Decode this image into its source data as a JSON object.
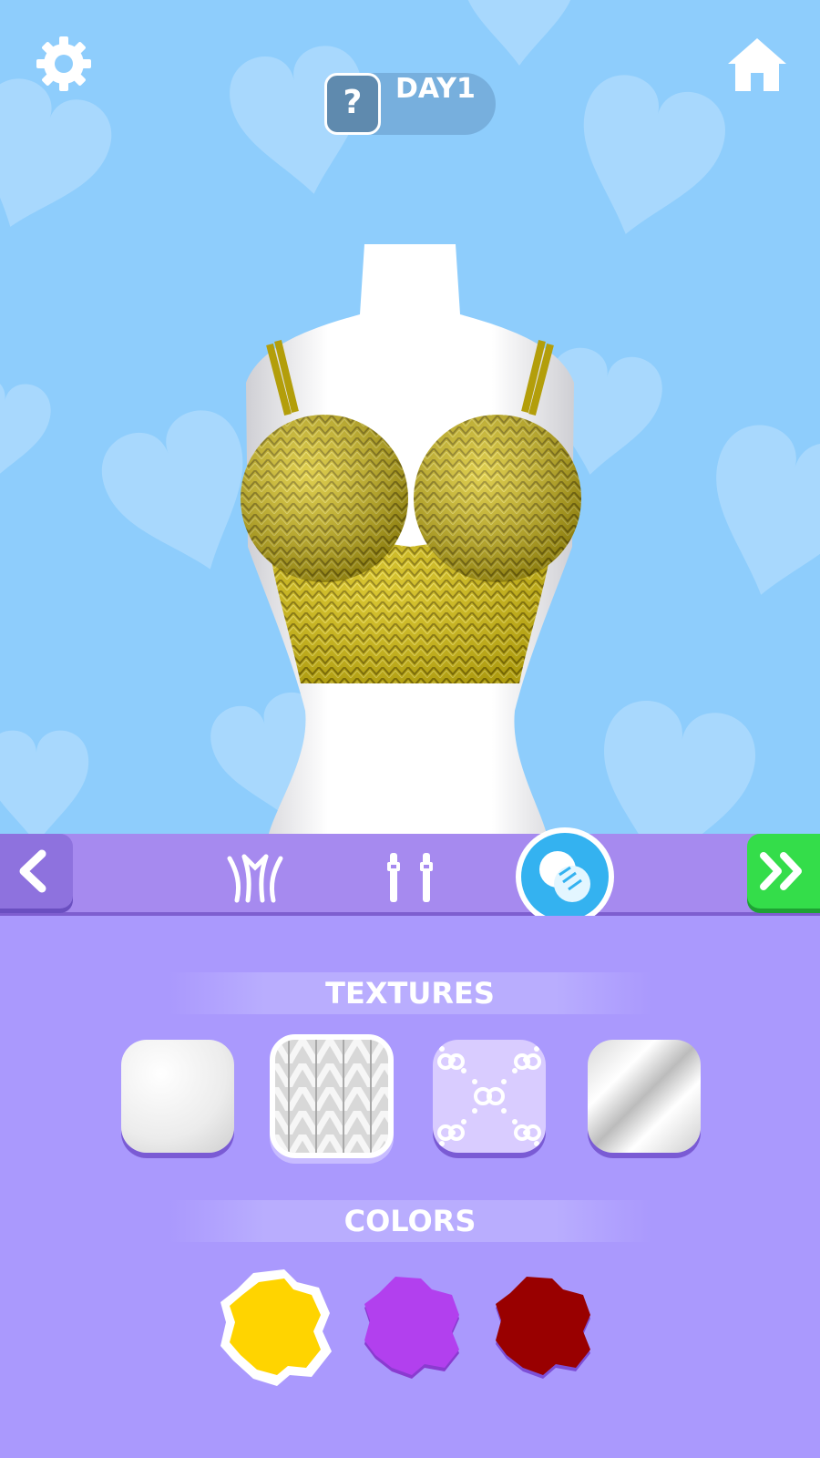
{
  "header": {
    "day_label": "DAY1",
    "help_glyph": "?",
    "settings_icon": "gear-icon",
    "home_icon": "home-icon"
  },
  "garment": {
    "type": "bralette crop top",
    "color": "#d8c21a"
  },
  "toolbar": {
    "tabs": [
      {
        "icon": "shape-style-icon",
        "active": false
      },
      {
        "icon": "straps-icon",
        "active": false
      },
      {
        "icon": "fabric-texture-icon",
        "active": true
      }
    ],
    "back_icon": "chevron-left-icon",
    "next_icon": "double-chevron-right-icon"
  },
  "textures": {
    "title": "TEXTURES",
    "items": [
      {
        "name": "plain",
        "selected": false
      },
      {
        "name": "knit",
        "selected": true
      },
      {
        "name": "pattern",
        "selected": false
      },
      {
        "name": "satin",
        "selected": false
      }
    ]
  },
  "colors": {
    "title": "COLORS",
    "items": [
      {
        "hex": "#ffd400",
        "selected": true
      },
      {
        "hex": "#b240ee",
        "selected": false
      },
      {
        "hex": "#990000",
        "selected": false
      }
    ]
  },
  "theme": {
    "sky": "#8ecdfc",
    "panel": "#aa99fd",
    "toolbar": "#a68aef",
    "next_button": "#34dd4a",
    "active_tab": "#34b2f0"
  }
}
